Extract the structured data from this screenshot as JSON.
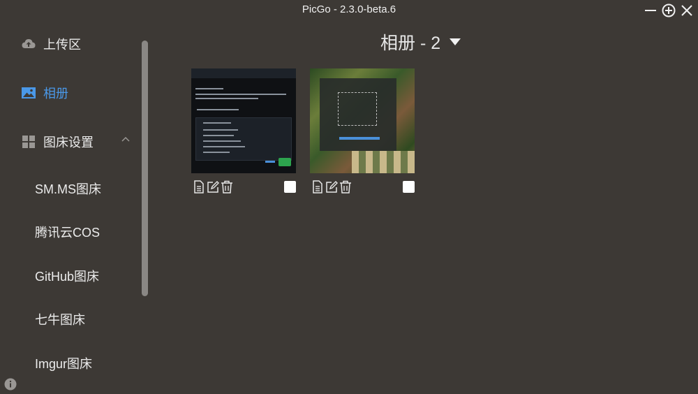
{
  "window": {
    "title": "PicGo - 2.3.0-beta.6"
  },
  "sidebar": {
    "items": [
      {
        "label": "上传区",
        "icon": "cloud-upload-icon"
      },
      {
        "label": "相册",
        "icon": "image-icon",
        "active": true
      },
      {
        "label": "图床设置",
        "icon": "grid-icon"
      }
    ],
    "sub_items": [
      {
        "label": "SM.MS图床"
      },
      {
        "label": "腾讯云COS"
      },
      {
        "label": "GitHub图床"
      },
      {
        "label": "七牛图床"
      },
      {
        "label": "Imgur图床"
      }
    ]
  },
  "gallery": {
    "title": "相册 - 2",
    "images": [
      {
        "name": "dark-dialog-screenshot",
        "checked": false
      },
      {
        "name": "jungle-screenshot",
        "checked": false
      }
    ]
  },
  "colors": {
    "background": "#3d3935",
    "accent": "#4a98e8",
    "text": "#e8e8e8"
  }
}
